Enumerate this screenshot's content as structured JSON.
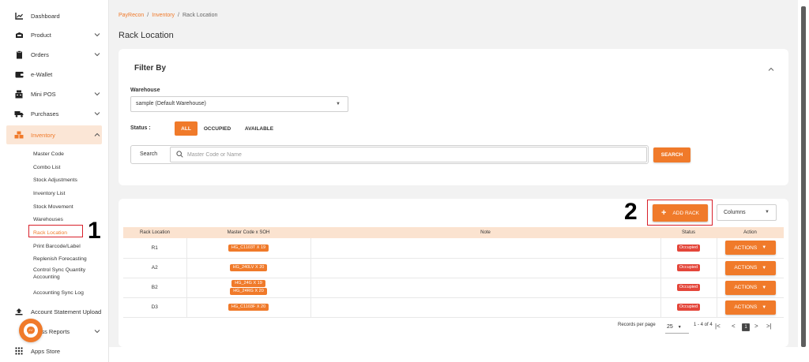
{
  "sidebar": {
    "items": [
      {
        "label": "Dashboard",
        "icon": "chart-icon"
      },
      {
        "label": "Product",
        "icon": "box-icon"
      },
      {
        "label": "Orders",
        "icon": "clipboard-icon"
      },
      {
        "label": "e-Wallet",
        "icon": "wallet-icon"
      },
      {
        "label": "Mini POS",
        "icon": "pos-icon"
      },
      {
        "label": "Purchases",
        "icon": "truck-icon"
      },
      {
        "label": "Inventory",
        "icon": "boxes-icon"
      },
      {
        "label": "Account Statement Upload",
        "icon": "upload-icon"
      },
      {
        "label": "Business Reports",
        "icon": "report-icon"
      },
      {
        "label": "Apps Store",
        "icon": "grid-icon"
      }
    ],
    "inventory_sub": [
      "Master Code",
      "Combo List",
      "Stock Adjustments",
      "Inventory List",
      "Stock Movement",
      "Warehouses",
      "Rack Location",
      "Print Barcode/Label",
      "Replenish Forecasting",
      "Control Sync Quantity Accounting",
      "Accounting Sync Log"
    ],
    "business_reports_visible": "ness Reports"
  },
  "annotations": {
    "marker1": "1",
    "marker2": "2"
  },
  "breadcrumb": {
    "root": "PayRecon",
    "section": "Inventory",
    "current": "Rack Location"
  },
  "page_title": "Rack Location",
  "filter": {
    "title": "Filter By",
    "warehouse_label": "Warehouse",
    "warehouse_value": "sample (Default Warehouse)",
    "status_label": "Status :",
    "status_options": [
      "ALL",
      "OCCUPIED",
      "AVAILABLE"
    ],
    "status_selected": "ALL",
    "search_label": "Search",
    "search_placeholder": "Master Code or Name",
    "search_button": "SEARCH"
  },
  "table": {
    "add_button": "ADD RACK",
    "columns_select": "Columns",
    "headers": [
      "Rack Location",
      "Master Code x SOH",
      "Note",
      "Status",
      "Action"
    ],
    "rows": [
      {
        "rack": "R1",
        "codes": [
          "HG_C1103T X 19"
        ],
        "note": "",
        "status": "Occupied",
        "action": "ACTIONS"
      },
      {
        "rack": "A2",
        "codes": [
          "HG_240LV X 20"
        ],
        "note": "",
        "status": "Occupied",
        "action": "ACTIONS"
      },
      {
        "rack": "B2",
        "codes": [
          "HG_24G X 19",
          "HG_24RG X 20"
        ],
        "note": "",
        "status": "Occupied",
        "action": "ACTIONS"
      },
      {
        "rack": "D3",
        "codes": [
          "HG_C1103F X 20"
        ],
        "note": "",
        "status": "Occupied",
        "action": "ACTIONS"
      }
    ],
    "pagination": {
      "records_label": "Records per page",
      "per_page": "25",
      "range": "1 - 4 of 4",
      "current_page": "1"
    }
  },
  "colors": {
    "accent": "#f07a2a",
    "status_occupied": "#e4463a",
    "highlight": "#d8202a"
  }
}
